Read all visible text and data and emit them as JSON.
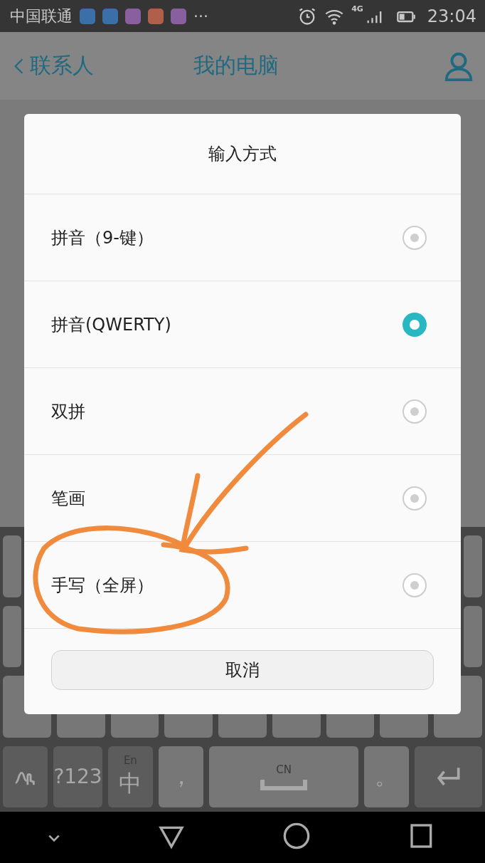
{
  "status_bar": {
    "carrier": "中国联通",
    "more": "···",
    "network": "4G",
    "time": "23:04"
  },
  "header": {
    "back_label": "联系人",
    "title": "我的电脑"
  },
  "keyboard": {
    "bottom_row": [
      {
        "kind": "handwrite"
      },
      {
        "kind": "symbols",
        "label": "?123"
      },
      {
        "kind": "lang",
        "label": "中",
        "hint": "En"
      },
      {
        "kind": "comma",
        "label": "，"
      },
      {
        "kind": "space",
        "hint": "CN"
      },
      {
        "kind": "period",
        "label": "。"
      },
      {
        "kind": "enter"
      }
    ]
  },
  "dialog": {
    "title": "输入方式",
    "options": [
      {
        "label": "拼音（9-键）",
        "selected": false
      },
      {
        "label": "拼音(QWERTY)",
        "selected": true
      },
      {
        "label": "双拼",
        "selected": false
      },
      {
        "label": "笔画",
        "selected": false
      },
      {
        "label": "手写（全屏）",
        "selected": false
      }
    ],
    "cancel": "取消"
  }
}
